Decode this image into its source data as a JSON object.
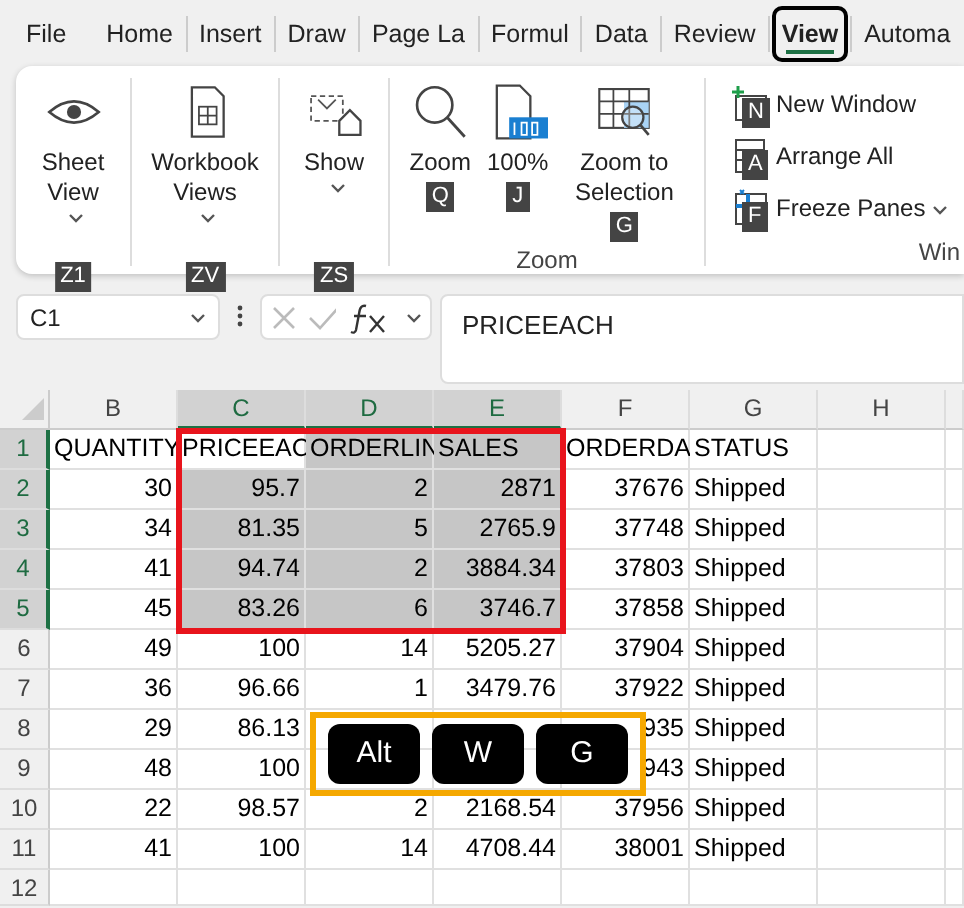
{
  "tabs": [
    {
      "label": "File",
      "selected": false
    },
    {
      "label": "Home",
      "selected": false
    },
    {
      "label": "Insert",
      "selected": false
    },
    {
      "label": "Draw",
      "selected": false
    },
    {
      "label": "Page La",
      "selected": false
    },
    {
      "label": "Formul",
      "selected": false
    },
    {
      "label": "Data",
      "selected": false
    },
    {
      "label": "Review",
      "selected": false
    },
    {
      "label": "View",
      "selected": true
    },
    {
      "label": "Automa",
      "selected": false
    }
  ],
  "ribbon": {
    "groups": [
      {
        "kind": "large",
        "buttons": [
          {
            "label": "Sheet View",
            "dropdown": true,
            "key_tip": "Z1"
          }
        ]
      },
      {
        "kind": "large",
        "buttons": [
          {
            "label": "Workbook Views",
            "dropdown": true,
            "key_tip": "ZV"
          }
        ]
      },
      {
        "kind": "large",
        "buttons": [
          {
            "label": "Show",
            "dropdown": true,
            "key_tip": "ZS"
          }
        ]
      },
      {
        "kind": "large",
        "label": "Zoom",
        "buttons": [
          {
            "label": "Zoom",
            "dropdown": false,
            "key_tip": "Q"
          },
          {
            "label": "100%",
            "dropdown": false,
            "key_tip": "J"
          },
          {
            "label": "Zoom to Selection",
            "dropdown": false,
            "key_tip": "G"
          }
        ]
      },
      {
        "kind": "small",
        "label": "Win",
        "buttons": [
          {
            "label": "New Window",
            "dropdown": false,
            "key_tip": "N"
          },
          {
            "label": "Arrange All",
            "dropdown": false,
            "key_tip": "A"
          },
          {
            "label": "Freeze Panes",
            "dropdown": true,
            "key_tip": "F"
          }
        ]
      }
    ]
  },
  "formula_bar": {
    "name_box": "C1",
    "formula": "PRICEEACH"
  },
  "sheet": {
    "columns": [
      {
        "label": "B",
        "kind": "number",
        "selected": false
      },
      {
        "label": "C",
        "kind": "number",
        "selected": true
      },
      {
        "label": "D",
        "kind": "number",
        "selected": true
      },
      {
        "label": "E",
        "kind": "number",
        "selected": true
      },
      {
        "label": "F",
        "kind": "number",
        "selected": false
      },
      {
        "label": "G",
        "kind": "text",
        "selected": false
      },
      {
        "label": "H",
        "kind": "text",
        "selected": false
      }
    ],
    "rows": [
      {
        "label": "1",
        "kind": "header",
        "selected": true,
        "cells": [
          "QUANTITY",
          "PRICEEAC",
          "ORDERLIN",
          "SALES",
          "ORDERDA",
          "STATUS",
          null
        ]
      },
      {
        "label": "2",
        "kind": "data",
        "selected": true,
        "cells": [
          "30",
          "95.7",
          "2",
          "2871",
          "37676",
          "Shipped",
          null
        ]
      },
      {
        "label": "3",
        "kind": "data",
        "selected": true,
        "cells": [
          "34",
          "81.35",
          "5",
          "2765.9",
          "37748",
          "Shipped",
          null
        ]
      },
      {
        "label": "4",
        "kind": "data",
        "selected": true,
        "cells": [
          "41",
          "94.74",
          "2",
          "3884.34",
          "37803",
          "Shipped",
          null
        ]
      },
      {
        "label": "5",
        "kind": "data",
        "selected": true,
        "cells": [
          "45",
          "83.26",
          "6",
          "3746.7",
          "37858",
          "Shipped",
          null
        ]
      },
      {
        "label": "6",
        "kind": "data",
        "selected": false,
        "cells": [
          "49",
          "100",
          "14",
          "5205.27",
          "37904",
          "Shipped",
          null
        ]
      },
      {
        "label": "7",
        "kind": "data",
        "selected": false,
        "cells": [
          "36",
          "96.66",
          "1",
          "3479.76",
          "37922",
          "Shipped",
          null
        ]
      },
      {
        "label": "8",
        "kind": "data",
        "selected": false,
        "cells": [
          "29",
          "86.13",
          null,
          null,
          "935",
          "Shipped",
          null
        ]
      },
      {
        "label": "9",
        "kind": "data",
        "selected": false,
        "cells": [
          "48",
          "100",
          null,
          null,
          "943",
          "Shipped",
          null
        ]
      },
      {
        "label": "10",
        "kind": "data",
        "selected": false,
        "cells": [
          "22",
          "98.57",
          "2",
          "2168.54",
          "37956",
          "Shipped",
          null
        ]
      },
      {
        "label": "11",
        "kind": "data",
        "selected": false,
        "cells": [
          "41",
          "100",
          "14",
          "4708.44",
          "38001",
          "Shipped",
          null
        ]
      },
      {
        "label": "12",
        "kind": "data",
        "selected": false,
        "cells": [
          null,
          null,
          null,
          null,
          null,
          null,
          null
        ]
      }
    ]
  },
  "key_sequence": [
    "Alt",
    "W",
    "G"
  ]
}
